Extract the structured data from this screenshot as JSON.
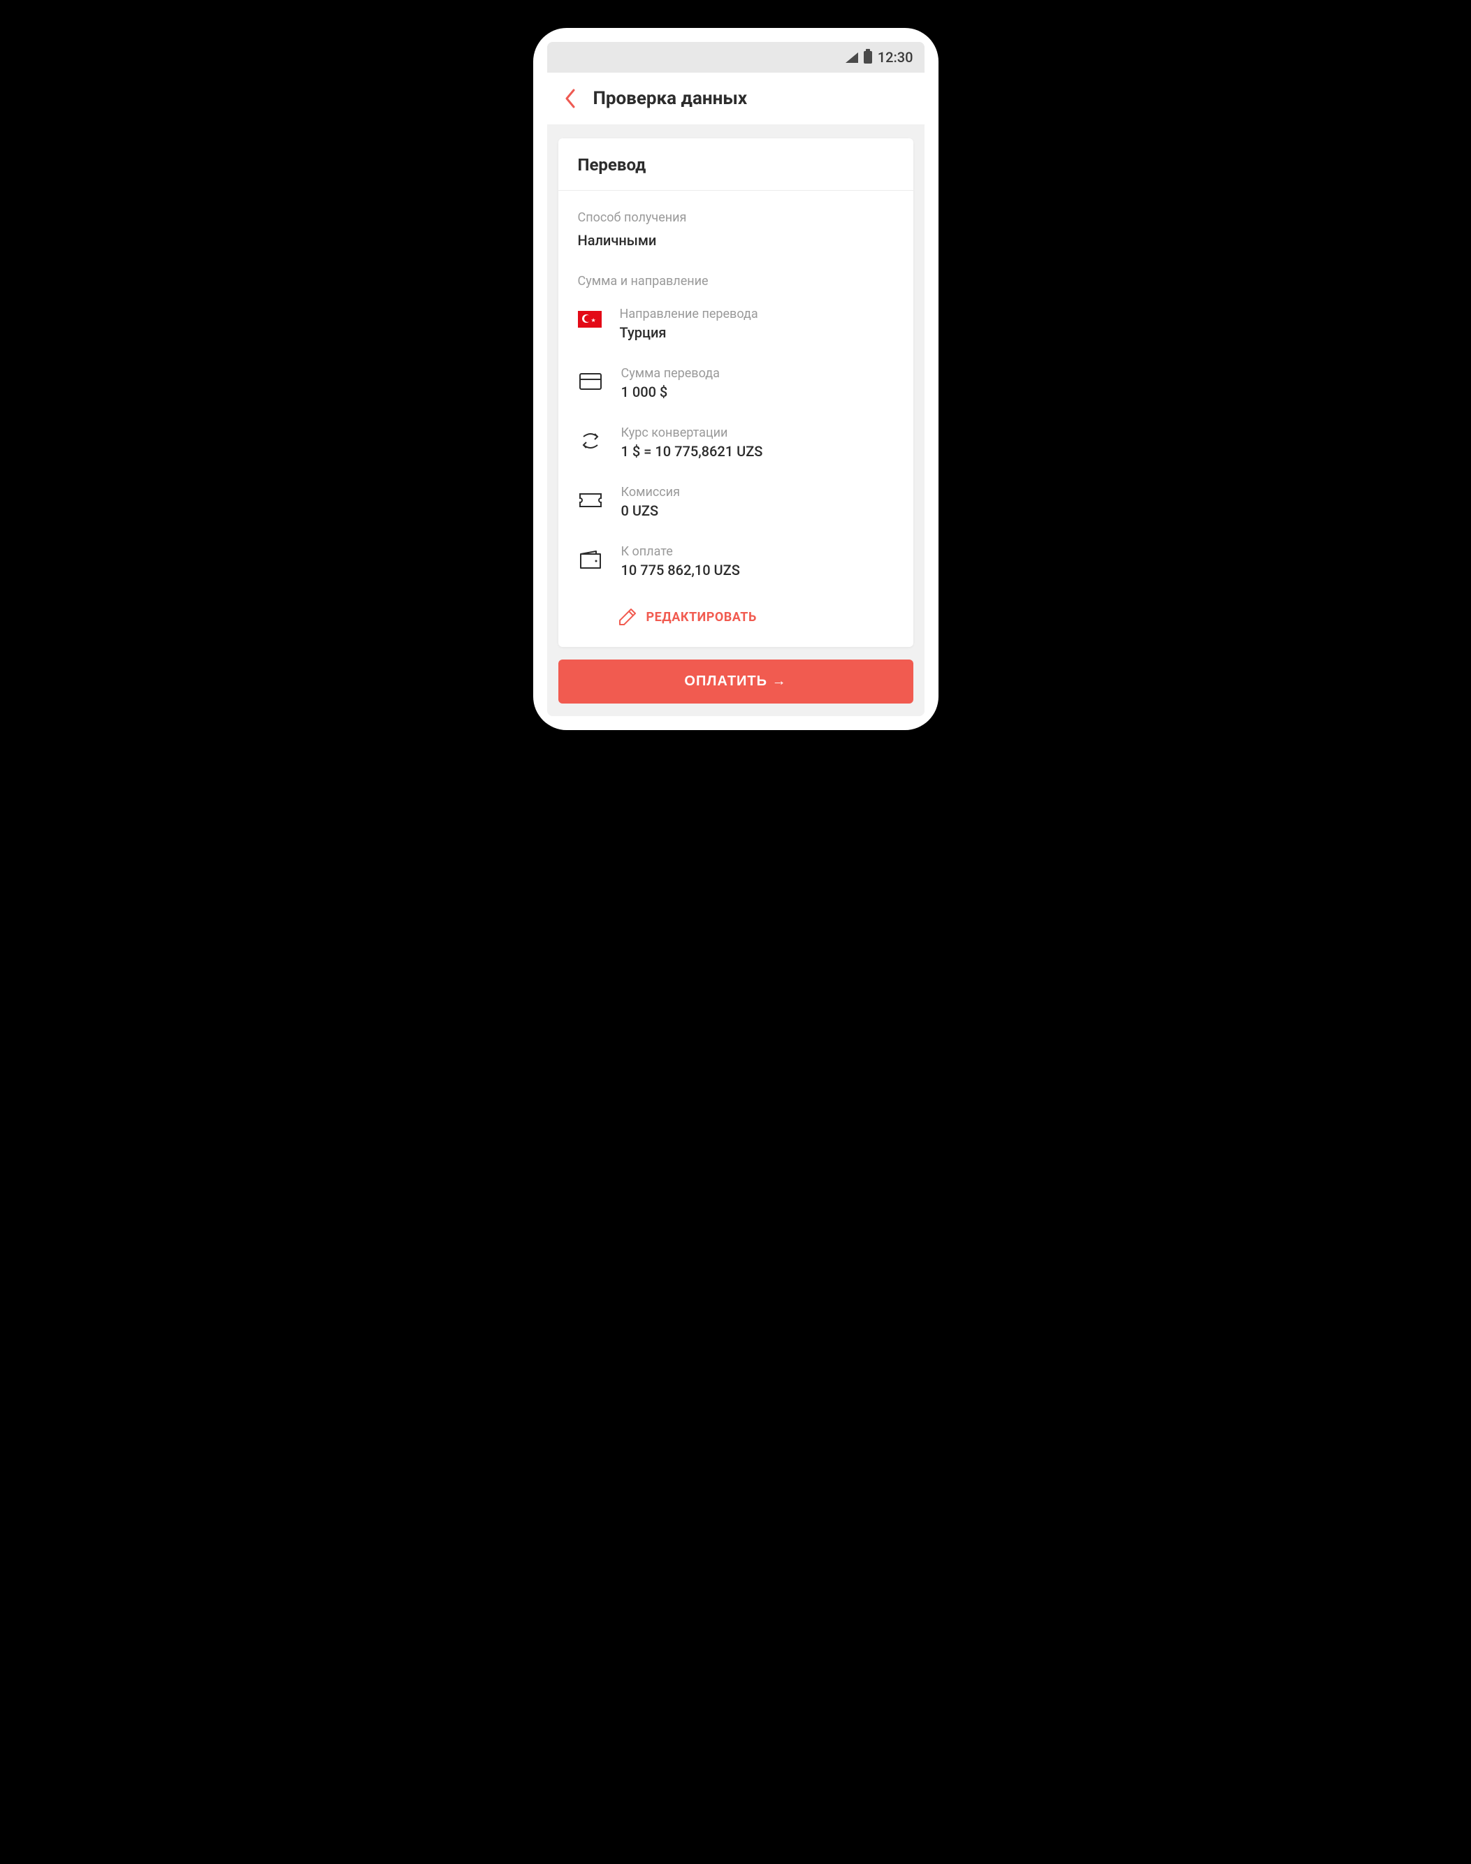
{
  "statusBar": {
    "time": "12:30"
  },
  "header": {
    "title": "Проверка данных"
  },
  "card": {
    "title": "Перевод",
    "receiveMethod": {
      "label": "Способ получения",
      "value": "Наличными"
    },
    "amountSectionLabel": "Сумма и направление",
    "rows": {
      "direction": {
        "label": "Направление перевода",
        "value": "Турция"
      },
      "amount": {
        "label": "Сумма перевода",
        "value": "1 000 $"
      },
      "rate": {
        "label": "Курс конвертации",
        "value": "1 $ = 10 775,8621 UZS"
      },
      "commission": {
        "label": "Комиссия",
        "value": "0 UZS"
      },
      "total": {
        "label": "К оплате",
        "value": "10 775 862,10 UZS"
      }
    },
    "editLabel": "РЕДАКТИРОВАТЬ"
  },
  "payButton": {
    "label": "ОПЛАТИТЬ →"
  }
}
